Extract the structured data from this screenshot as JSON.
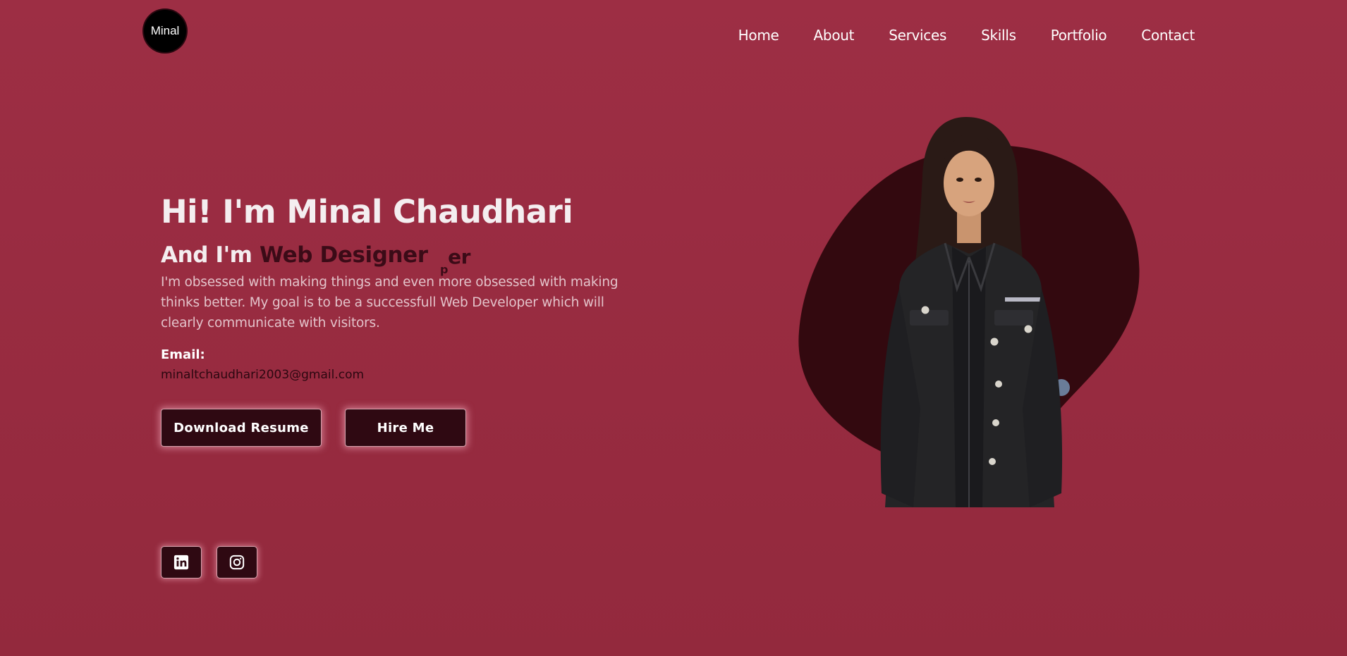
{
  "header": {
    "logo_text": "Minal",
    "nav": [
      "Home",
      "About",
      "Services",
      "Skills",
      "Portfolio",
      "Contact"
    ]
  },
  "hero": {
    "title": "Hi! I'm Minal Chaudhari",
    "subtitle_prefix": "And I'm",
    "role": "Web Designer",
    "ghost_text_drop": "p",
    "ghost_text_tail": "er",
    "description": "I'm obsessed with making things and even more obsessed with making thinks better. My goal is to be a successfull Web Developer which will clearly communicate with visitors.",
    "email_label": "Email:",
    "email_value": "minaltchaudhari2003@gmail.com",
    "buttons": {
      "resume": "Download Resume",
      "hire": "Hire Me"
    }
  },
  "social": {
    "linkedin_icon": "linkedin-icon",
    "instagram_icon": "instagram-icon"
  },
  "colors": {
    "background": "#9a2d42",
    "accent_dark": "#2f0912",
    "blob": "#33090f",
    "text_light": "#f4eef0",
    "text_dark": "#3b0b17"
  }
}
